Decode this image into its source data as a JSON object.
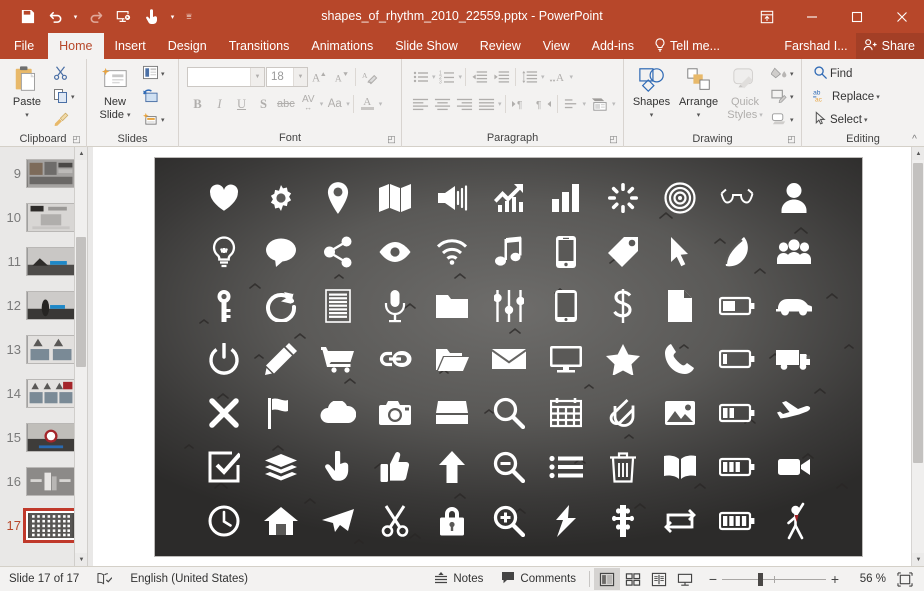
{
  "app": {
    "title": "shapes_of_rhythm_2010_22559.pptx - PowerPoint",
    "accent_color": "#b7472a"
  },
  "quick_access": {
    "items": [
      {
        "name": "save-icon",
        "label": "Save"
      },
      {
        "name": "undo-icon",
        "label": "Undo"
      },
      {
        "name": "redo-icon",
        "label": "Redo"
      },
      {
        "name": "start-presentation-icon",
        "label": "Start From Beginning"
      },
      {
        "name": "touch-mode-icon",
        "label": "Touch/Mouse Mode"
      },
      {
        "name": "customize-qat-icon",
        "label": "Customize Quick Access Toolbar"
      }
    ]
  },
  "window_controls": {
    "ribbon_options": "Ribbon Display Options",
    "minimize": "Minimize",
    "restore": "Restore Down",
    "close": "Close"
  },
  "tabs": [
    {
      "label": "File",
      "active": false
    },
    {
      "label": "Home",
      "active": true
    },
    {
      "label": "Insert",
      "active": false
    },
    {
      "label": "Design",
      "active": false
    },
    {
      "label": "Transitions",
      "active": false
    },
    {
      "label": "Animations",
      "active": false
    },
    {
      "label": "Slide Show",
      "active": false
    },
    {
      "label": "Review",
      "active": false
    },
    {
      "label": "View",
      "active": false
    },
    {
      "label": "Add-ins",
      "active": false
    }
  ],
  "tab_right": {
    "tell_me": "Tell me...",
    "account": "Farshad I...",
    "share": "Share"
  },
  "ribbon": {
    "clipboard": {
      "label": "Clipboard",
      "paste": "Paste",
      "cut": "Cut",
      "copy": "Copy",
      "format_painter": "Format Painter"
    },
    "slides": {
      "label": "Slides",
      "new_slide": "New\nSlide",
      "new_slide_l1": "New",
      "new_slide_l2": "Slide",
      "layout": "Layout",
      "reset": "Reset",
      "section": "Section"
    },
    "font": {
      "label": "Font",
      "font_name_value": "",
      "font_name_placeholder": "",
      "font_size_value": "18",
      "bold": "B",
      "italic": "I",
      "underline": "U",
      "shadow": "S",
      "strikethrough": "abc",
      "char_spacing": "AV",
      "change_case": "Aa",
      "font_color": "A",
      "clear_formatting": "Clear All Formatting",
      "increase_size": "A",
      "decrease_size": "A"
    },
    "paragraph": {
      "label": "Paragraph",
      "bullets": "Bullets",
      "numbering": "Numbering",
      "decrease_indent": "Decrease List Level",
      "increase_indent": "Increase List Level",
      "line_spacing": "Line Spacing",
      "text_direction": "Text Direction",
      "align_text": "Align Text",
      "convert_smartart": "Convert to SmartArt",
      "align_left": "Align Left",
      "center": "Center",
      "align_right": "Align Right",
      "justify": "Justify",
      "columns": "Columns"
    },
    "drawing": {
      "label": "Drawing",
      "shapes": "Shapes",
      "arrange": "Arrange",
      "quick_styles_l1": "Quick",
      "quick_styles_l2": "Styles",
      "shape_fill": "Shape Fill",
      "shape_outline": "Shape Outline",
      "shape_effects": "Shape Effects"
    },
    "editing": {
      "label": "Editing",
      "find": "Find",
      "replace": "Replace",
      "select": "Select",
      "collapse_ribbon": "Collapse the Ribbon"
    }
  },
  "thumbnails": {
    "selected": 17,
    "items": [
      {
        "number": "9",
        "selected": false
      },
      {
        "number": "10",
        "selected": false
      },
      {
        "number": "11",
        "selected": false
      },
      {
        "number": "12",
        "selected": false
      },
      {
        "number": "13",
        "selected": false
      },
      {
        "number": "14",
        "selected": false
      },
      {
        "number": "15",
        "selected": false
      },
      {
        "number": "16",
        "selected": false
      },
      {
        "number": "17",
        "selected": true
      }
    ]
  },
  "slide": {
    "background": "#5a5957",
    "icon_color": "#ffffff",
    "accent_tie_color": "#a4252a",
    "icons": [
      "heart-icon",
      "gear-icon",
      "location-pin-icon",
      "map-icon",
      "speaker-icon",
      "growth-chart-icon",
      "bar-chart-icon",
      "loading-spinner-icon",
      "target-icon",
      "glasses-icon",
      "person-icon",
      "lightbulb-icon",
      "speech-bubble-icon",
      "share-icon",
      "eye-icon",
      "wifi-icon",
      "music-note-icon",
      "smartphone-icon",
      "tag-icon",
      "cursor-arrow-icon",
      "feather-icon",
      "group-people-icon",
      "key-icon",
      "refresh-icon",
      "document-lines-icon",
      "microphone-icon",
      "folder-icon",
      "sliders-icon",
      "tablet-icon",
      "dollar-icon",
      "file-icon",
      "battery-half-icon",
      "car-icon",
      "power-icon",
      "pencil-icon",
      "shopping-cart-icon",
      "link-icon",
      "open-folder-icon",
      "envelope-icon",
      "monitor-icon",
      "star-icon",
      "phone-icon",
      "battery-low-icon",
      "truck-icon",
      "close-x-icon",
      "flag-icon",
      "cloud-icon",
      "camera-icon",
      "inbox-tray-icon",
      "search-icon",
      "calendar-grid-icon",
      "paperclip-icon",
      "image-icon",
      "battery-two-bar-icon",
      "airplane-icon",
      "checkbox-icon",
      "layers-icon",
      "pointing-hand-icon",
      "thumbs-up-icon",
      "arrow-up-icon",
      "zoom-out-icon",
      "list-icon",
      "trash-icon",
      "book-icon",
      "battery-three-bar-icon",
      "video-camera-icon",
      "clock-icon",
      "home-icon",
      "send-plane-icon",
      "scissors-icon",
      "lock-icon",
      "zoom-in-icon",
      "lightning-icon",
      "puzzle-icon",
      "loop-repeat-icon",
      "battery-full-icon",
      "figure-person-icon"
    ]
  },
  "status_bar": {
    "slide_counter": "Slide 17 of 17",
    "spell_check": "Spelling Check",
    "language": "English (United States)",
    "notes": "Notes",
    "comments": "Comments",
    "views": [
      {
        "name": "normal-view-button",
        "label": "Normal",
        "active": true
      },
      {
        "name": "slide-sorter-button",
        "label": "Slide Sorter",
        "active": false
      },
      {
        "name": "reading-view-button",
        "label": "Reading View",
        "active": false
      },
      {
        "name": "slide-show-button",
        "label": "Slide Show",
        "active": false
      }
    ],
    "zoom_out": "−",
    "zoom_in": "+",
    "zoom_level": "56 %",
    "fit_to_window": "Fit slide to current window"
  }
}
